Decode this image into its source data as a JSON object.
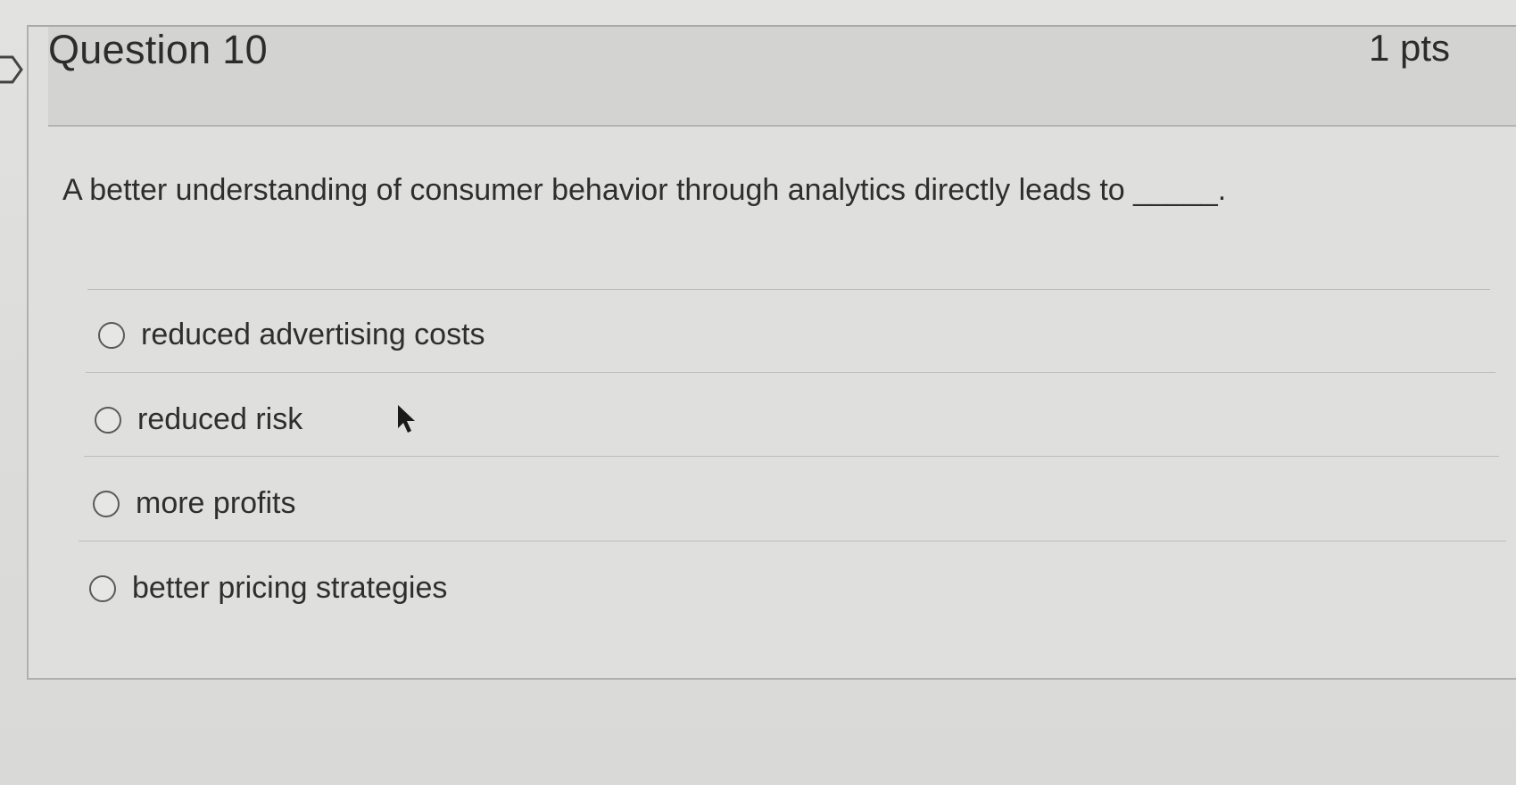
{
  "question": {
    "title": "Question 10",
    "points": "1 pts",
    "text": "A better understanding of consumer behavior through analytics directly leads to _____."
  },
  "answers": [
    {
      "label": "reduced advertising costs",
      "selected": false
    },
    {
      "label": "reduced risk",
      "selected": false
    },
    {
      "label": "more profits",
      "selected": false
    },
    {
      "label": "better pricing strategies",
      "selected": false
    }
  ],
  "icons": {
    "flag": "flag-icon",
    "cursor": "mouse-pointer-icon",
    "radio": "radio-unchecked-icon"
  },
  "colors": {
    "background": "#dcdcda",
    "header_background": "#d3d3d1",
    "text": "#2c2c2c",
    "divider": "#bdbdbb"
  }
}
